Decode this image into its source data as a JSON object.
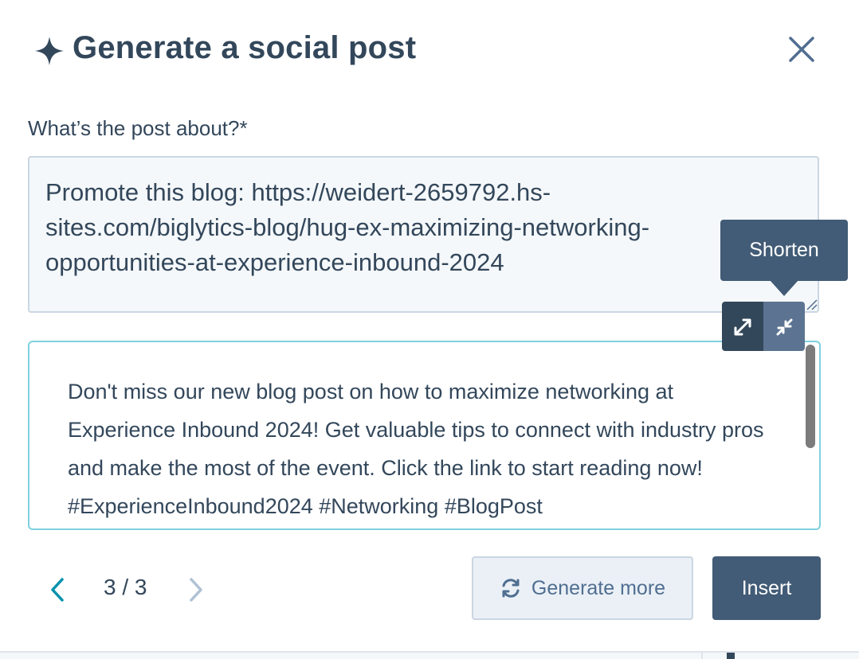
{
  "dialog": {
    "title": "Generate a social post",
    "close_icon": "close-icon",
    "header_icon": "sparkle-icon"
  },
  "prompt": {
    "label": "What’s the post about?*",
    "value": "Promote this blog: https://weidert-2659792.hs-\nsites.com/biglytics-blog/hug-ex-maximizing-networking-\nopportunities-at-experience-inbound-2024"
  },
  "tooltip": {
    "text": "Shorten"
  },
  "length_controls": {
    "expand_icon": "expand-icon",
    "shorten_icon": "shorten-icon"
  },
  "result": {
    "text": "Don't miss our new blog post on how to maximize networking at Experience Inbound 2024! Get valuable tips to connect with industry pros and make the most of the event. Click the link to start reading now! #ExperienceInbound2024 #Networking #BlogPost"
  },
  "pagination": {
    "label": "3 / 3",
    "current": 3,
    "total": 3
  },
  "actions": {
    "generate_more_label": "Generate more",
    "insert_label": "Insert"
  },
  "colors": {
    "text": "#33475b",
    "primary": "#425b76",
    "accent_border": "#7fd1de",
    "input_bg": "#f5f8fa",
    "link_blue": "#0091ae"
  }
}
